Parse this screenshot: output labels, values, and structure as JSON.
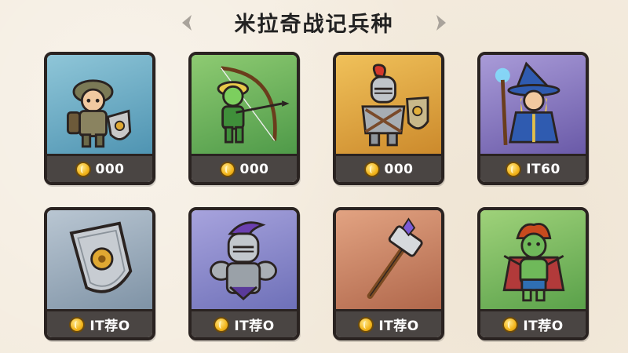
{
  "header": {
    "title": "米拉奇战记兵种"
  },
  "cards": [
    {
      "unit_icon": "soldier-icon",
      "price": "000",
      "theme_color": "#5a9fbc"
    },
    {
      "unit_icon": "archer-icon",
      "price": "000",
      "theme_color": "#5fa652"
    },
    {
      "unit_icon": "knight-icon",
      "price": "000",
      "theme_color": "#d99a38"
    },
    {
      "unit_icon": "wizard-icon",
      "price": "IT60",
      "theme_color": "#7a6ab6"
    },
    {
      "unit_icon": "shield-icon",
      "price": "IT荐O",
      "theme_color": "#8da0b2"
    },
    {
      "unit_icon": "armored-knight-icon",
      "price": "IT荐O",
      "theme_color": "#7a7cc2"
    },
    {
      "unit_icon": "hammer-icon",
      "price": "IT荐O",
      "theme_color": "#c07a5a"
    },
    {
      "unit_icon": "goblin-icon",
      "price": "IT荐O",
      "theme_color": "#66ad52"
    }
  ],
  "colors": {
    "background": "#f4ecdf",
    "card_border": "#2a2321",
    "price_bar": "#4a4543",
    "coin": "#f2b41a"
  }
}
